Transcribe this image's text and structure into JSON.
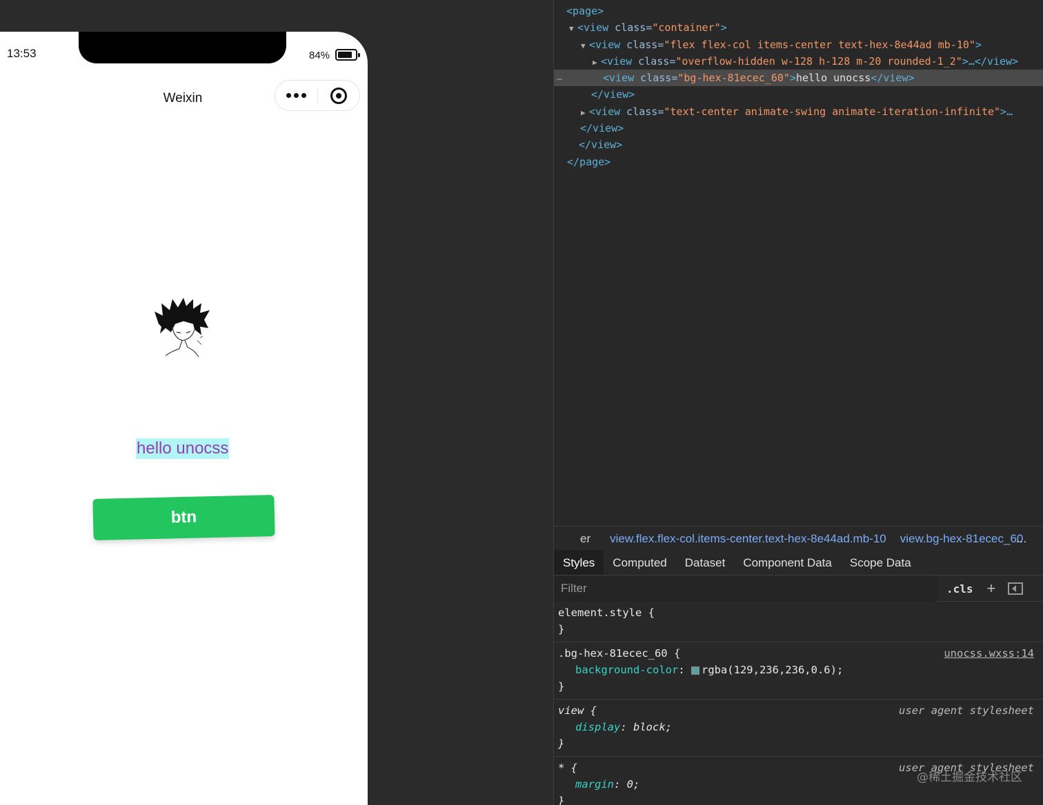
{
  "phone": {
    "time": "13:53",
    "battery_pct": "84%",
    "battery_level": 0.84,
    "nav_title": "Weixin",
    "hello_text": "hello unocss",
    "button_label": "btn",
    "colors": {
      "hello_text": "#8e44ad",
      "hello_bg": "rgba(129,236,236,0.6)",
      "button_bg": "#22c55e"
    }
  },
  "devtools": {
    "tree": {
      "page_open": "<page>",
      "container_open_tag": "<view",
      "container_attr": " class=",
      "container_val": "\"container\"",
      "gt": ">",
      "flex_val": "\"flex flex-col items-center text-hex-8e44ad mb-10\"",
      "overflow_val": "\"overflow-hidden w-128 h-128 m-20 rounded-1_2\"",
      "overflow_tail": ">…</view>",
      "bg_val": "\"bg-hex-81ecec_60\"",
      "bg_text": "hello unocss",
      "close_view": "</view>",
      "swing_val": "\"text-center animate-swing animate-iteration-infinite\"",
      "swing_tail": ">…",
      "page_close": "</page>",
      "ellipsis": "…"
    },
    "breadcrumbs": {
      "cut": "er",
      "flex": "view.flex.flex-col.items-center.text-hex-8e44ad.mb-10",
      "bg": "view.bg-hex-81ecec_60",
      "more": "…"
    },
    "tabs": [
      "Styles",
      "Computed",
      "Dataset",
      "Component Data",
      "Scope Data"
    ],
    "filter_placeholder": "Filter",
    "cls_label": ".cls",
    "plus_label": "+",
    "rules": {
      "element_style": "element.style {",
      "close": "}",
      "bg_selector": ".bg-hex-81ecec_60 {",
      "bg_source": "unocss.wxss:14",
      "bg_prop": "background-color",
      "bg_value": "rgba(129,236,236,0.6);",
      "view_selector": "view {",
      "ua_source": "user agent stylesheet",
      "display_prop": "display",
      "display_value": "block;",
      "star_selector": "* {",
      "margin_prop": "margin",
      "margin_value": "0;"
    },
    "watermark": "@稀土掘金技术社区"
  }
}
